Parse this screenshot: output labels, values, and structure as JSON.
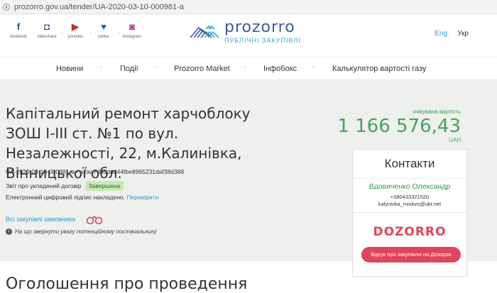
{
  "browser": {
    "url": "prozorro.gov.ua/tender/UA-2020-03-10-000981-a"
  },
  "social": [
    {
      "icon": "facebook-icon",
      "glyph": "f",
      "label": "facebook"
    },
    {
      "icon": "slideshare-icon",
      "glyph": "◘",
      "label": "slideshare"
    },
    {
      "icon": "youtube-icon",
      "glyph": "▶",
      "label": "youtube"
    },
    {
      "icon": "twitter-icon",
      "glyph": "♥",
      "label": "twitter"
    },
    {
      "icon": "instagram-icon",
      "glyph": "◙",
      "label": "instagram"
    }
  ],
  "logo": {
    "name": "prozorro",
    "subtitle": "ПУБЛІЧНІ ЗАКУПІВЛІ"
  },
  "lang": {
    "eng": "Eng",
    "ukr": "Укр"
  },
  "nav": [
    {
      "label": "Новини"
    },
    {
      "label": "Події"
    },
    {
      "label": "Prozorro Market"
    },
    {
      "label": "Інфобокс"
    },
    {
      "label": "Калькулятор вартості газу"
    }
  ],
  "tender": {
    "title": "Капітальний ремонт харчоблоку ЗОШ І-ІІІ ст. №1 по вул. Незалежності, 22, м.Калинівка, Вінницької обл.",
    "id": "UA-2020-03-10-000981-a",
    "hash": "a2aa7d03dad44fbe8965231daf38d388",
    "report_label": "Звіт про укладений договір",
    "status": "Завершена",
    "signature_text": "Електронний цифровий підпис накладено.",
    "verify_link": "Перевірити",
    "all_purchases": "Всі закупівлі замовника",
    "attention": "На що звернути увагу потенційному постачальнику"
  },
  "price": {
    "label": "очікувана вартість",
    "amount": "1 166 576,43",
    "currency": "UAH"
  },
  "contacts": {
    "heading": "Контакти",
    "name": "Вдовиченко Олександр",
    "phone": "+380433321520",
    "email": "kalynivka_miskvo@ukr.net"
  },
  "dozorro": {
    "logo": "DOZORRO",
    "button": "Відгук про закупівлю на Дозорро"
  },
  "announcement": "Оголошення про проведення",
  "colors": {
    "green": "#48a15a",
    "blue_link": "#2d9ad6",
    "dozorro_red": "#e0445a",
    "brand_blue": "#3b5aa8"
  }
}
